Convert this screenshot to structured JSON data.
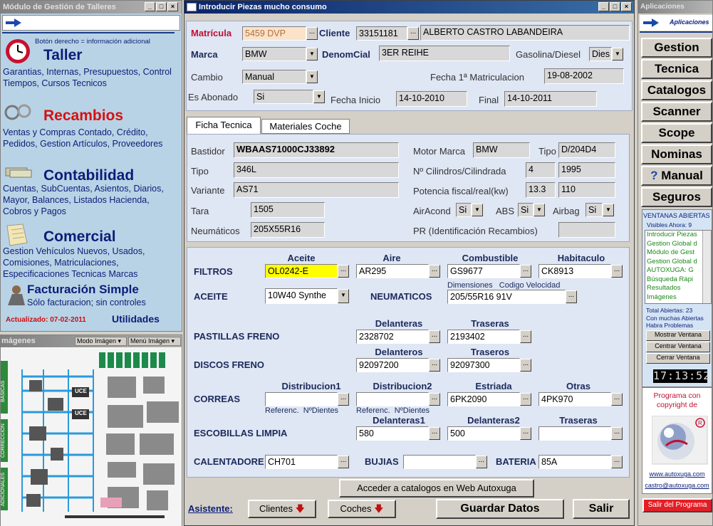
{
  "left_window": {
    "title": "Módulo de Gestión de Talleres",
    "hint": "Botón derecho = información adicional",
    "modules": [
      {
        "name": "Taller",
        "desc": "Garantias, Internas, Presupuestos, Control Tiempos, Cursos Tecnicos"
      },
      {
        "name": "Recambios",
        "desc": "Ventas y Compras Contado, Crédito, Pedidos, Gestion Artículos, Proveedores"
      },
      {
        "name": "Contabilidad",
        "desc": "Cuentas, SubCuentas, Asientos, Diarios, Mayor, Balances, Listados Hacienda, Cobros y Pagos"
      },
      {
        "name": "Comercial",
        "desc": "Gestion Vehículos Nuevos, Usados, Comisiones, Matriculaciones, Especificaciones Tecnicas Marcas"
      },
      {
        "name": "Facturación Simple",
        "desc": "Sólo facturacion; sin controles"
      }
    ],
    "updated": "Actualizado: 07-02-2011",
    "utilities": "Utilidades"
  },
  "images_window": {
    "title": "mágenes",
    "mode_label": "Modo Imágen",
    "menu_label": "Menú Imágen",
    "side_labels": [
      "BÁSICAS",
      "CORRECCIÓN",
      "ADICIONALES"
    ],
    "diagram_labels": [
      "UCE",
      "UCE"
    ]
  },
  "main": {
    "title": "Introducir Piezas mucho consumo",
    "matricula_label": "Matrícula",
    "matricula": "5459 DVP",
    "cliente_label": "Cliente",
    "cliente_code": "33151181",
    "cliente_name": "ALBERTO CASTRO LABANDEIRA",
    "marca_label": "Marca",
    "marca": "BMW",
    "denom_label": "DenomCial",
    "denom": "3ER REIHE",
    "fuel_label": "Gasolina/Diesel",
    "fuel": "Dies",
    "cambio_label": "Cambio",
    "cambio": "Manual",
    "fecha_mat_label": "Fecha 1ª Matriculacion",
    "fecha_mat": "19-08-2002",
    "abonado_label": "Es Abonado",
    "abonado": "Si",
    "fecha_inicio_label": "Fecha Inicio",
    "fecha_inicio": "14-10-2010",
    "final_label": "Final",
    "final": "14-10-2011",
    "tabs": [
      "Ficha Tecnica",
      "Materiales Coche"
    ],
    "ficha": {
      "bastidor_label": "Bastidor",
      "bastidor": "WBAAS71000CJ33892",
      "tipo_label": "Tipo",
      "tipo": "346L",
      "variante_label": "Variante",
      "variante": "AS71",
      "tara_label": "Tara",
      "tara": "1505",
      "neumaticos_label": "Neumáticos",
      "neumaticos": "205X55R16",
      "motor_label": "Motor Marca",
      "motor": "BMW",
      "tipo2_label": "Tipo",
      "tipo2": "D/204D4",
      "cilindros_label": "Nº Cilindros/Cilindrada",
      "cilindros": "4",
      "cilindrada": "1995",
      "potencia_label": "Potencia fiscal/real(kw)",
      "potencia_fiscal": "13.3",
      "potencia_real": "110",
      "aircond_label": "AirAcond",
      "aircond": "Si",
      "abs_label": "ABS",
      "abs": "Si",
      "airbag_label": "Airbag",
      "airbag": "Si",
      "pr_label": "PR (Identificación Recambios)",
      "pr": ""
    },
    "parts": {
      "filtros_label": "FILTROS",
      "aceite_h": "Aceite",
      "aire_h": "Aire",
      "combustible_h": "Combustible",
      "habitaculo_h": "Habitaculo",
      "f_aceite": "OL0242-E",
      "f_aire": "AR295",
      "f_comb": "GS9677",
      "f_habit": "CK8913",
      "aceite_label": "ACEITE",
      "aceite_type": "10W40 Synthe",
      "neum_label": "NEUMATICOS",
      "neum_sub": "Dimensiones   Codigo Velocidad",
      "neum": "205/55R16 91V",
      "pastillas_label": "PASTILLAS FRENO",
      "delanteras_h": "Delanteras",
      "traseras_h": "Traseras",
      "past_del": "2328702",
      "past_tras": "2193402",
      "discos_label": "DISCOS FRENO",
      "delanteros_h": "Delanteros",
      "traseros_h": "Traseros",
      "disc_del": "92097200",
      "disc_tras": "92097300",
      "correas_label": "CORREAS",
      "dist1_h": "Distribucion1",
      "dist2_h": "Distribucion2",
      "estriada_h": "Estriada",
      "otras_h": "Otras",
      "dist1": "",
      "dist2": "",
      "estriada": "6PK2090",
      "otras": "4PK970",
      "referenc": "Referenc.  NºDientes",
      "escob_label": "ESCOBILLAS LIMPIA",
      "del1_h": "Delanteras1",
      "del2_h": "Delanteras2",
      "tras_h": "Traseras",
      "esc_del1": "580",
      "esc_del2": "500",
      "esc_tras": "",
      "calent_label": "CALENTADORE",
      "calent": "CH701",
      "bujias_label": "BUJIAS",
      "bujias": "",
      "bateria_label": "BATERIA",
      "bateria": "85A"
    },
    "web_button": "Acceder a catalogos en Web Autoxuga",
    "asistente_label": "Asistente:",
    "clientes_btn": "Clientes",
    "coches_btn": "Coches",
    "guardar_btn": "Guardar Datos",
    "salir_btn": "Salir"
  },
  "apps": {
    "title": "Aplicaciones",
    "header": "Aplicaciones",
    "buttons": [
      "Gestion",
      "Tecnica",
      "Catalogos",
      "Scanner",
      "Scope",
      "Nominas",
      "Manual",
      "Seguros"
    ],
    "ventanas_title": "VENTANAS ABIERTAS",
    "visibles": "Visibles Ahora: 9",
    "window_list": [
      "Introducir Piezas",
      "Gestion Global d",
      "Módulo de Gest",
      "Gestion Global d",
      "AUTOXUGA: G",
      "Búsqueda Rápi",
      "Resultados",
      "Imágenes"
    ],
    "total": "Total Abiertas: 23",
    "muchas": "Con muchas Abiertas",
    "problemas": "Habra Problemas",
    "mostrar": "Mostrar Ventana",
    "centrar": "Centrar Ventana",
    "cerrar": "Cerrar Ventana",
    "clock": "17:13:52",
    "copyright": "Programa con copyright de",
    "website": "www.autoxuga.com",
    "email": "castro@autoxuga.com",
    "salir": "Salir del Programa"
  }
}
